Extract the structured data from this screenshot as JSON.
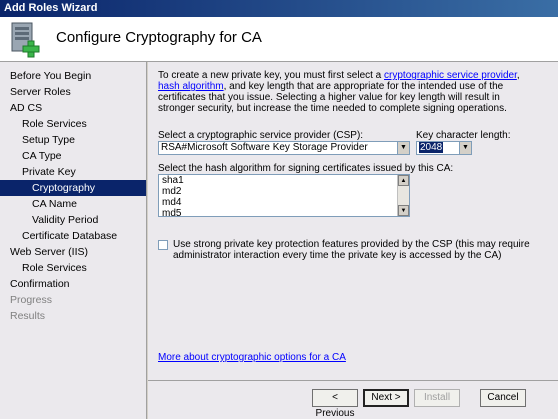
{
  "window": {
    "title": "Add Roles Wizard"
  },
  "header": {
    "title": "Configure Cryptography for CA",
    "icon": "server-roles-add-icon"
  },
  "sidebar": {
    "items": [
      {
        "label": "Before You Begin",
        "level": 0,
        "state": "normal"
      },
      {
        "label": "Server Roles",
        "level": 0,
        "state": "normal"
      },
      {
        "label": "AD CS",
        "level": 0,
        "state": "normal"
      },
      {
        "label": "Role Services",
        "level": 1,
        "state": "normal"
      },
      {
        "label": "Setup Type",
        "level": 1,
        "state": "normal"
      },
      {
        "label": "CA Type",
        "level": 1,
        "state": "normal"
      },
      {
        "label": "Private Key",
        "level": 1,
        "state": "normal"
      },
      {
        "label": "Cryptography",
        "level": 2,
        "state": "selected"
      },
      {
        "label": "CA Name",
        "level": 2,
        "state": "normal"
      },
      {
        "label": "Validity Period",
        "level": 2,
        "state": "normal"
      },
      {
        "label": "Certificate Database",
        "level": 1,
        "state": "normal"
      },
      {
        "label": "Web Server (IIS)",
        "level": 0,
        "state": "normal"
      },
      {
        "label": "Role Services",
        "level": 1,
        "state": "normal"
      },
      {
        "label": "Confirmation",
        "level": 0,
        "state": "normal"
      },
      {
        "label": "Progress",
        "level": 0,
        "state": "disabled"
      },
      {
        "label": "Results",
        "level": 0,
        "state": "disabled"
      }
    ]
  },
  "main": {
    "description": {
      "part1": "To create a new private key, you must first select a ",
      "link1": "cryptographic service provider",
      "part2": ", ",
      "link2": "hash algorithm",
      "part3": ", and key length that are appropriate for the intended use of the certificates that you issue. Selecting a higher value for key length will result in stronger security, but increase the time needed to complete signing operations."
    },
    "csp_label": "Select a cryptographic service provider (CSP):",
    "csp_value": "RSA#Microsoft Software Key Storage Provider",
    "key_length_label": "Key character length:",
    "key_length_value": "2048",
    "hash_label": "Select the hash algorithm for signing certificates issued by this CA:",
    "hash_options": [
      "sha1",
      "md2",
      "md4",
      "md5"
    ],
    "strong_protection_label": "Use strong private key protection features provided by the CSP (this may require administrator interaction every time the private key is accessed by the CA)",
    "strong_protection_checked": false,
    "more_link": "More about cryptographic options for a CA"
  },
  "footer": {
    "previous_label": "< Previous",
    "next_label": "Next >",
    "install_label": "Install",
    "cancel_label": "Cancel"
  }
}
